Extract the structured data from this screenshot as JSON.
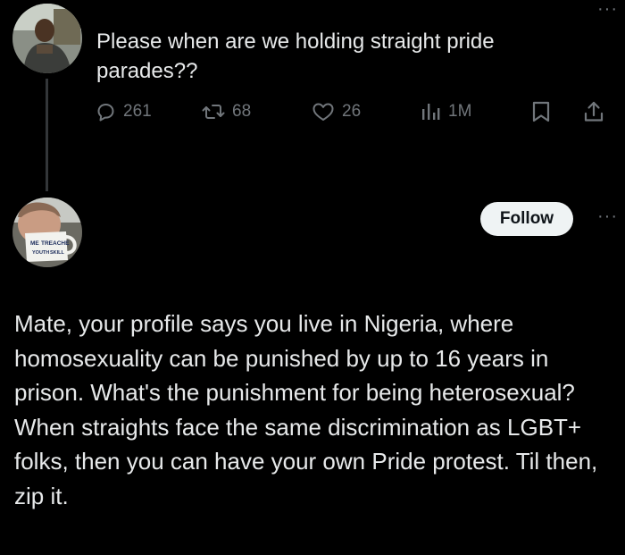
{
  "tweet": {
    "text": "Please when are we holding straight pride parades??",
    "counts": {
      "replies": "261",
      "reposts": "68",
      "likes": "26",
      "views": "1M"
    }
  },
  "reply": {
    "follow_label": "Follow",
    "paragraphs": [
      "Mate, your profile says you live in Nigeria, where homosexuality can be punished by up to 16 years in prison. What's the punishment for being heterosexual?",
      "When straights face the same discrimination as LGBT+ folks, then you can have your own Pride protest. Til then, zip it."
    ],
    "avatar_mug_text": [
      "ME",
      "TREACHE",
      "YOUTH",
      "SKILL"
    ]
  },
  "icons": {
    "reply": "reply-icon",
    "repost": "repost-icon",
    "like": "heart-icon",
    "views": "views-icon",
    "bookmark": "bookmark-icon",
    "share": "share-icon",
    "more": "more-icon"
  },
  "colors": {
    "background": "#000000",
    "text": "#e7e9ea",
    "muted": "#71767b",
    "follow_bg": "#eff3f4",
    "thread_line": "#333639"
  }
}
